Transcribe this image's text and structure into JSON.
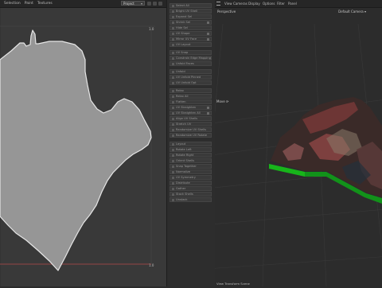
{
  "uv_editor": {
    "menu": [
      "Selection",
      "Paint",
      "Textures"
    ],
    "view_dropdown": "Project",
    "corner_top": "1.0",
    "corner_bottom": "1.0"
  },
  "middle_panel": {
    "rows": [
      "Select All",
      "Bright UV Shell",
      "Expand Sel",
      "Shrink Sel",
      "Hide Sel",
      "UV Shape",
      "Mirror UV Face",
      "UV Layout",
      "UV Snap",
      "Constrain Edge Mapping",
      "Unfold Faces",
      "Unfold",
      "UV Unfold Pinned",
      "UV Unfold Opt",
      "Relax",
      "Relax All",
      "Flatten",
      "UV Straighten",
      "UV Straighten All",
      "Align UV Shells",
      "Stretch UV",
      "Randomize UV Shells",
      "Randomize UV Rotate",
      "Layout",
      "Rotate Left",
      "Rotate Right",
      "Orient Shells",
      "Snap Together",
      "Normalize",
      "UV Symmetry",
      "Distribute",
      "Gather",
      "Stack Shells",
      "Unstack"
    ]
  },
  "viewport": {
    "menu": [
      "View",
      "Cameras",
      "Display",
      "Options",
      "Filter",
      "Panel"
    ],
    "label_persp": "Perspective",
    "label_camera": "Default Camera ▾",
    "label_move": "Move ⟳",
    "footer": "View  Transform  Scene"
  },
  "colors": {
    "uv_shell_fill": "#969696",
    "uv_shell_edge": "#e6e6e6",
    "terrain_base": "#17b51a",
    "terrain_tex_dark": "#3a2a28",
    "terrain_tex_red": "#9a4a48"
  }
}
